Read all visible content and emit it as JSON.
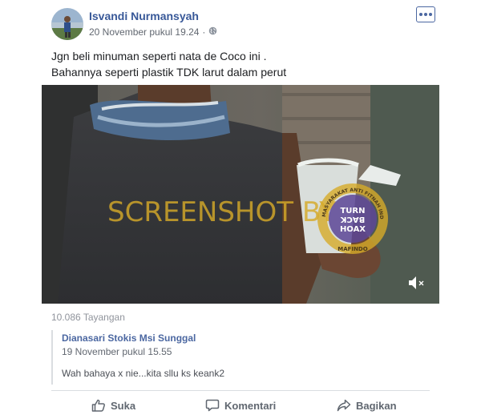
{
  "post": {
    "author": "Isvandi Nurmansyah",
    "timestamp": "20 November pukul 19.24",
    "separator": "·",
    "privacy_icon": "globe-icon",
    "more_icon": "ellipsis-icon",
    "text_lines": [
      "Jgn beli minuman seperti nata de Coco ini .",
      "Bahannya seperti plastik TDK larut dalam perut"
    ]
  },
  "video": {
    "watermark": "SCREENSHOT BY",
    "badge_ring_text": "MASYARAKAT ANTI FITNAH INDONESIA",
    "badge_bottom_text": "MAFINDO",
    "badge_center": [
      "TURN",
      "BACK",
      "HOAX"
    ],
    "mute_icon": "speaker-muted-icon"
  },
  "views": "10.086 Tayangan",
  "comment": {
    "author": "Dianasari Stokis Msi Sunggal",
    "timestamp": "19 November pukul 15.55",
    "text": "Wah bahaya x nie...kita sllu ks keank2"
  },
  "actions": {
    "like": "Suka",
    "comment": "Komentari",
    "share": "Bagikan"
  },
  "colors": {
    "link": "#385898",
    "secondary_text": "#616770",
    "watermark": "#d6aa28"
  }
}
